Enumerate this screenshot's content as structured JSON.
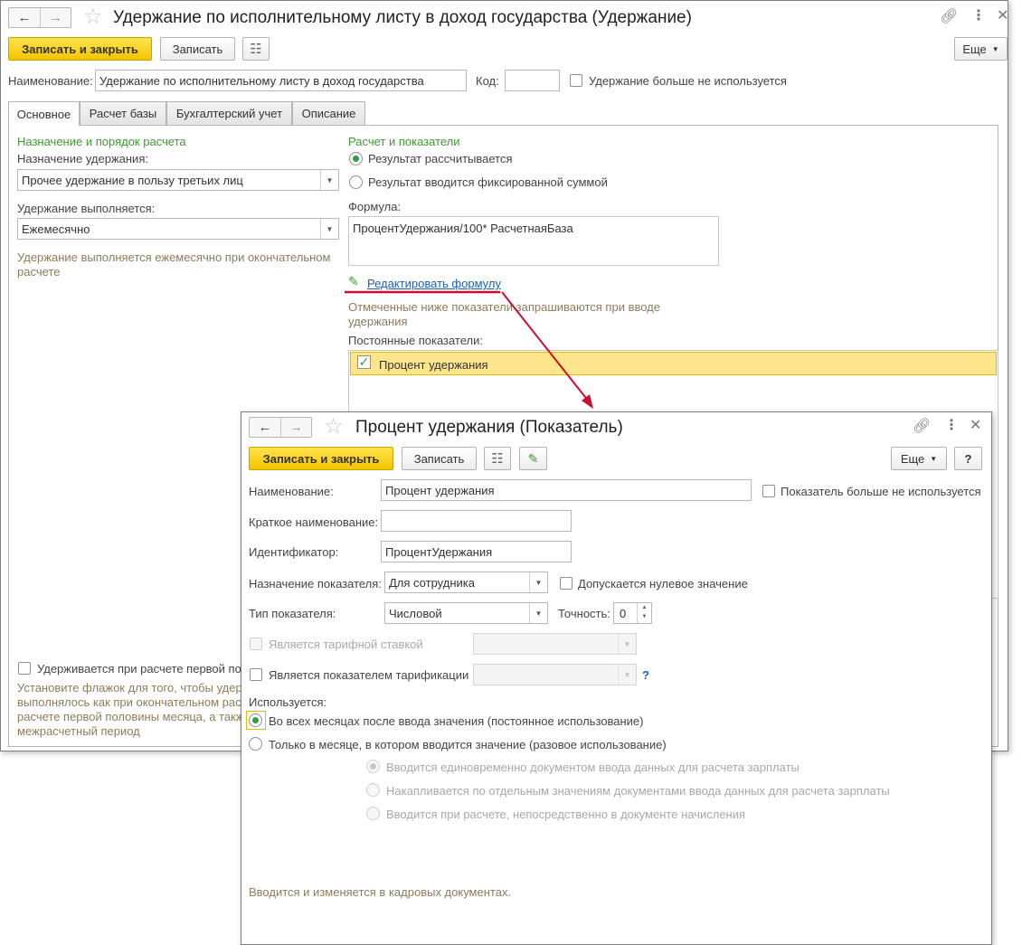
{
  "main_window": {
    "title": "Удержание по исполнительному листу в доход государства (Удержание)",
    "toolbar": {
      "save_close": "Записать и закрыть",
      "save": "Записать",
      "more": "Еще"
    },
    "name_label": "Наименование:",
    "name_value": "Удержание по исполнительному листу в доход государства",
    "code_label": "Код:",
    "code_value": "",
    "not_used_label": "Удержание больше не используется",
    "tabs": [
      {
        "label": "Основное",
        "active": true
      },
      {
        "label": "Расчет базы",
        "active": false
      },
      {
        "label": "Бухгалтерский учет",
        "active": false
      },
      {
        "label": "Описание",
        "active": false
      }
    ],
    "left": {
      "section_title": "Назначение и порядок расчета",
      "purpose_label": "Назначение удержания:",
      "purpose_value": "Прочее удержание в пользу третьих лиц",
      "performed_label": "Удержание выполняется:",
      "performed_value": "Ежемесячно",
      "hint_lines": [
        "Удержание выполняется ежемесячно при окончательном",
        "расчете"
      ],
      "first_half_label": "Удерживается при расчете первой по",
      "first_half_hint_lines": [
        "Установите флажок для того, чтобы удерж",
        "выполнялось как при окончательном рас",
        "расчете первой половины месяца, а такж",
        "межрасчетный период"
      ]
    },
    "right": {
      "section_title": "Расчет и показатели",
      "radio_calculated": "Результат рассчитывается",
      "radio_fixed": "Результат вводится фиксированной суммой",
      "formula_label": "Формула:",
      "formula_value": "ПроцентУдержания/100*  РасчетнаяБаза",
      "edit_formula_link": "Редактировать формулу",
      "requested_hint_lines": [
        "Отмеченные ниже показатели запрашиваются при вводе",
        "удержания"
      ],
      "constant_label": "Постоянные показатели:",
      "indicator_row": "Процент удержания"
    }
  },
  "dialog": {
    "title": "Процент удержания (Показатель)",
    "toolbar": {
      "save_close": "Записать и закрыть",
      "save": "Записать",
      "more": "Еще",
      "help": "?"
    },
    "name_label": "Наименование:",
    "name_value": "Процент удержания",
    "not_used_label": "Показатель больше не используется",
    "short_name_label": "Краткое наименование:",
    "short_name_value": "",
    "id_label": "Идентификатор:",
    "id_value": "ПроцентУдержания",
    "purpose_label": "Назначение показателя:",
    "purpose_value": "Для сотрудника",
    "zero_allowed_label": "Допускается нулевое значение",
    "type_label": "Тип показателя:",
    "type_value": "Числовой",
    "precision_label": "Точность:",
    "precision_value": "0",
    "tariff_rate_label": "Является тарифной ставкой",
    "tariff_indicator_label": "Является показателем тарификации",
    "tariff_help": "?",
    "used_label": "Используется:",
    "radio_all_months": "Во всех месяцах после ввода значения (постоянное использование)",
    "radio_one_month": "Только в месяце, в котором вводится значение (разовое использование)",
    "sub_radio_1": "Вводится единовременно документом ввода данных для расчета зарплаты",
    "sub_radio_2": "Накапливается по отдельным значениям документами ввода данных для расчета зарплаты",
    "sub_radio_3": "Вводится при расчете, непосредственно в документе начисления",
    "footer_hint": "Вводится и изменяется в кадровых документах."
  },
  "colors": {
    "accent_yellow": "#f5c400",
    "green": "#3d9b2f",
    "link": "#1a5fb4",
    "arrow": "#c8102e",
    "selected_row": "#fde68a"
  }
}
